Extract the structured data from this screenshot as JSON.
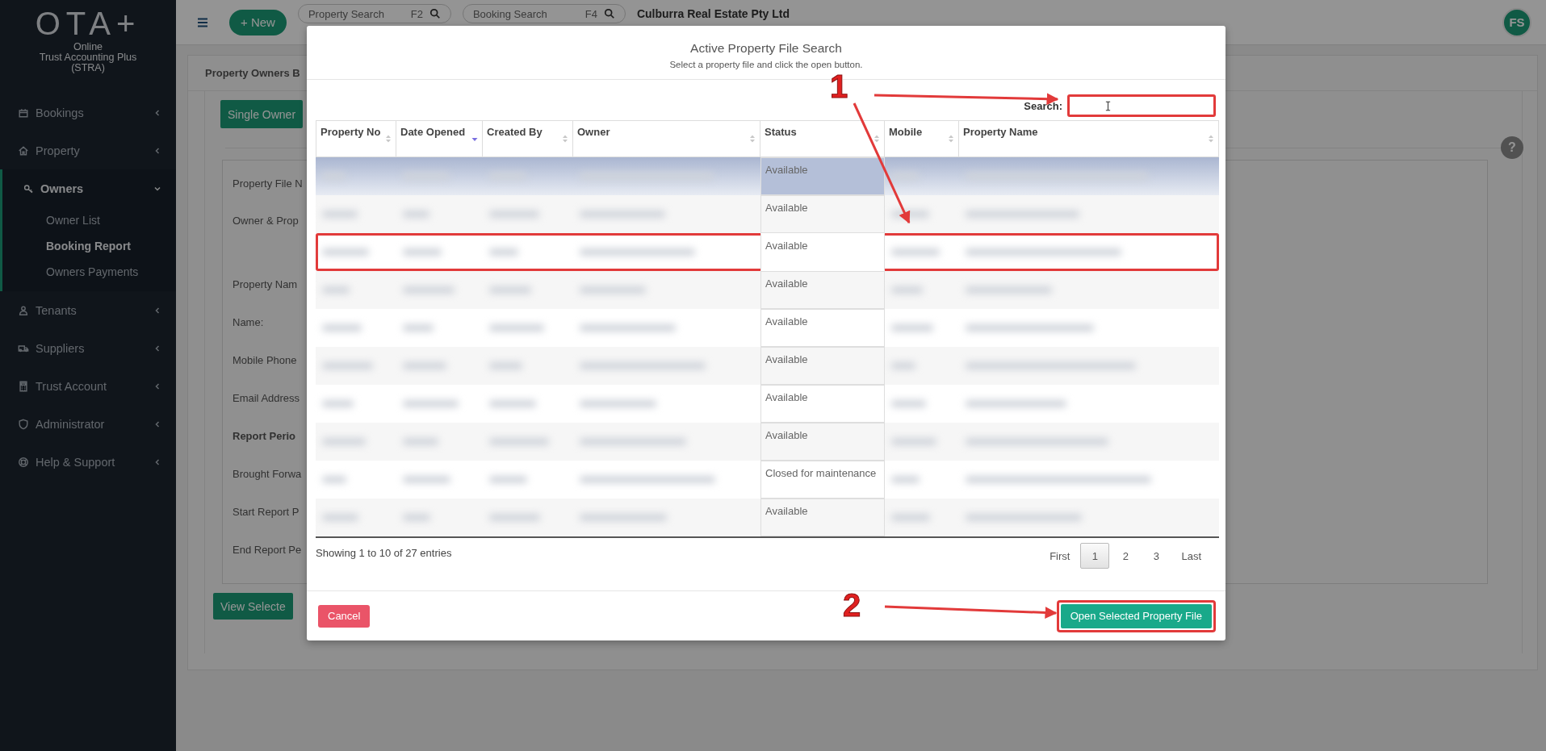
{
  "sidebar": {
    "logo": "OTA+",
    "subtitle_lines": [
      "Online",
      "Trust Accounting Plus",
      "(STRA)"
    ],
    "items": [
      {
        "label": "Bookings",
        "expanded": false
      },
      {
        "label": "Property",
        "expanded": false
      },
      {
        "label": "Owners",
        "expanded": true,
        "children": [
          {
            "label": "Owner List",
            "selected": false
          },
          {
            "label": "Booking Report",
            "selected": true
          },
          {
            "label": "Owners Payments",
            "selected": false
          }
        ]
      },
      {
        "label": "Tenants",
        "expanded": false
      },
      {
        "label": "Suppliers",
        "expanded": false
      },
      {
        "label": "Trust Account",
        "expanded": false
      },
      {
        "label": "Administrator",
        "expanded": false
      },
      {
        "label": "Help & Support",
        "expanded": false
      }
    ]
  },
  "topbar": {
    "new_button": "+ New",
    "property_search": {
      "placeholder": "Property Search",
      "shortcut": "F2"
    },
    "booking_search": {
      "placeholder": "Booking Search",
      "shortcut": "F4"
    },
    "company": "Culburra Real Estate Pty Ltd",
    "avatar": "FS"
  },
  "page": {
    "panel_title": "Property Owners B",
    "tab_button": "Single Owner",
    "help": "?",
    "form_labels": [
      {
        "text": "Property File N",
        "bold": false
      },
      {
        "text": "Owner & Prop",
        "bold": false
      },
      {
        "text": "Property Nam",
        "bold": false
      },
      {
        "text": "Name:",
        "bold": false
      },
      {
        "text": "Mobile Phone",
        "bold": false
      },
      {
        "text": "Email Address",
        "bold": false
      },
      {
        "text": "Report Perio",
        "bold": true
      },
      {
        "text": "Brought Forwa",
        "bold": false
      },
      {
        "text": "Start Report P",
        "bold": false
      },
      {
        "text": "End Report Pe",
        "bold": false
      }
    ],
    "view_button": "View Selecte"
  },
  "modal": {
    "title": "Active Property File Search",
    "subtitle": "Select a property file and click the open button.",
    "search": {
      "label": "Search:",
      "highlighted": true
    },
    "columns": [
      {
        "label": "Property No",
        "sorted": false
      },
      {
        "label": "Date Opened",
        "sorted": true
      },
      {
        "label": "Created By",
        "sorted": false
      },
      {
        "label": "Owner",
        "sorted": false
      },
      {
        "label": "Status",
        "sorted": false
      },
      {
        "label": "Mobile",
        "sorted": false
      },
      {
        "label": "Property Name",
        "sorted": false
      }
    ],
    "rows": [
      {
        "status": "Available",
        "selected": true,
        "highlighted": false
      },
      {
        "status": "Available",
        "selected": false,
        "highlighted": false
      },
      {
        "status": "Available",
        "selected": false,
        "highlighted": true
      },
      {
        "status": "Available",
        "selected": false,
        "highlighted": false
      },
      {
        "status": "Available",
        "selected": false,
        "highlighted": false
      },
      {
        "status": "Available",
        "selected": false,
        "highlighted": false
      },
      {
        "status": "Available",
        "selected": false,
        "highlighted": false
      },
      {
        "status": "Available",
        "selected": false,
        "highlighted": false
      },
      {
        "status": "Closed for maintenance",
        "selected": false,
        "highlighted": false
      },
      {
        "status": "Available",
        "selected": false,
        "highlighted": false
      }
    ],
    "info": "Showing 1 to 10 of 27 entries",
    "pagination": [
      {
        "label": "First",
        "selected": false
      },
      {
        "label": "1",
        "selected": true
      },
      {
        "label": "2",
        "selected": false
      },
      {
        "label": "3",
        "selected": false
      },
      {
        "label": "Last",
        "selected": false
      }
    ],
    "cancel_button": "Cancel",
    "open_button": {
      "label": "Open Selected Property File",
      "highlighted": true
    }
  },
  "annotations": [
    {
      "label": "1"
    },
    {
      "label": "2"
    }
  ]
}
